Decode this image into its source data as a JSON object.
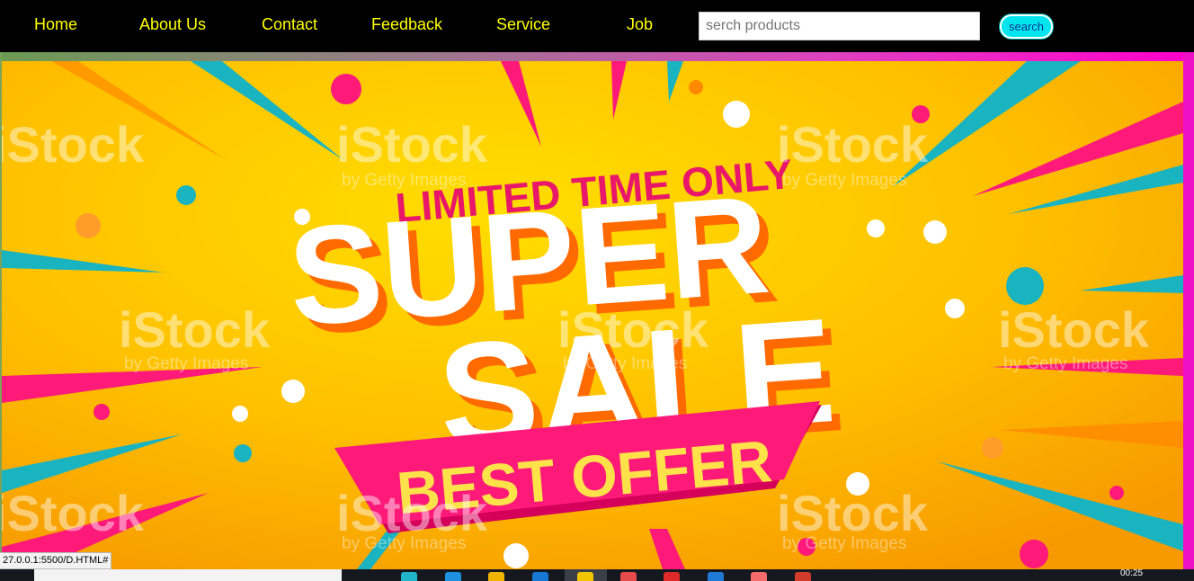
{
  "nav": {
    "links": [
      {
        "label": "Home"
      },
      {
        "label": "About Us"
      },
      {
        "label": "Contact"
      },
      {
        "label": "Feedback"
      },
      {
        "label": "Service"
      },
      {
        "label": "Job"
      }
    ],
    "search_placeholder": "serch products",
    "search_button": "search",
    "link_color": "#ffff00",
    "bar_color": "#000000",
    "button_color": "#00e5ee"
  },
  "banner": {
    "headline_top": "LIMITED TIME ONLY",
    "headline_main_1": "SUPER",
    "headline_main_2": "SALE",
    "ribbon_text": "BEST OFFER",
    "watermark_brand": "iStock",
    "watermark_sub": "by Getty Images",
    "colors": {
      "background": "#fbb400",
      "accent_pink": "#ff1a7a",
      "accent_teal": "#1ab3c0",
      "headline": "#ffffff",
      "ribbon_text": "#ffe14a"
    }
  },
  "status_bar": {
    "url": "27.0.0.1:5500/D.HTML#"
  },
  "taskbar": {
    "clock": "00:25"
  }
}
